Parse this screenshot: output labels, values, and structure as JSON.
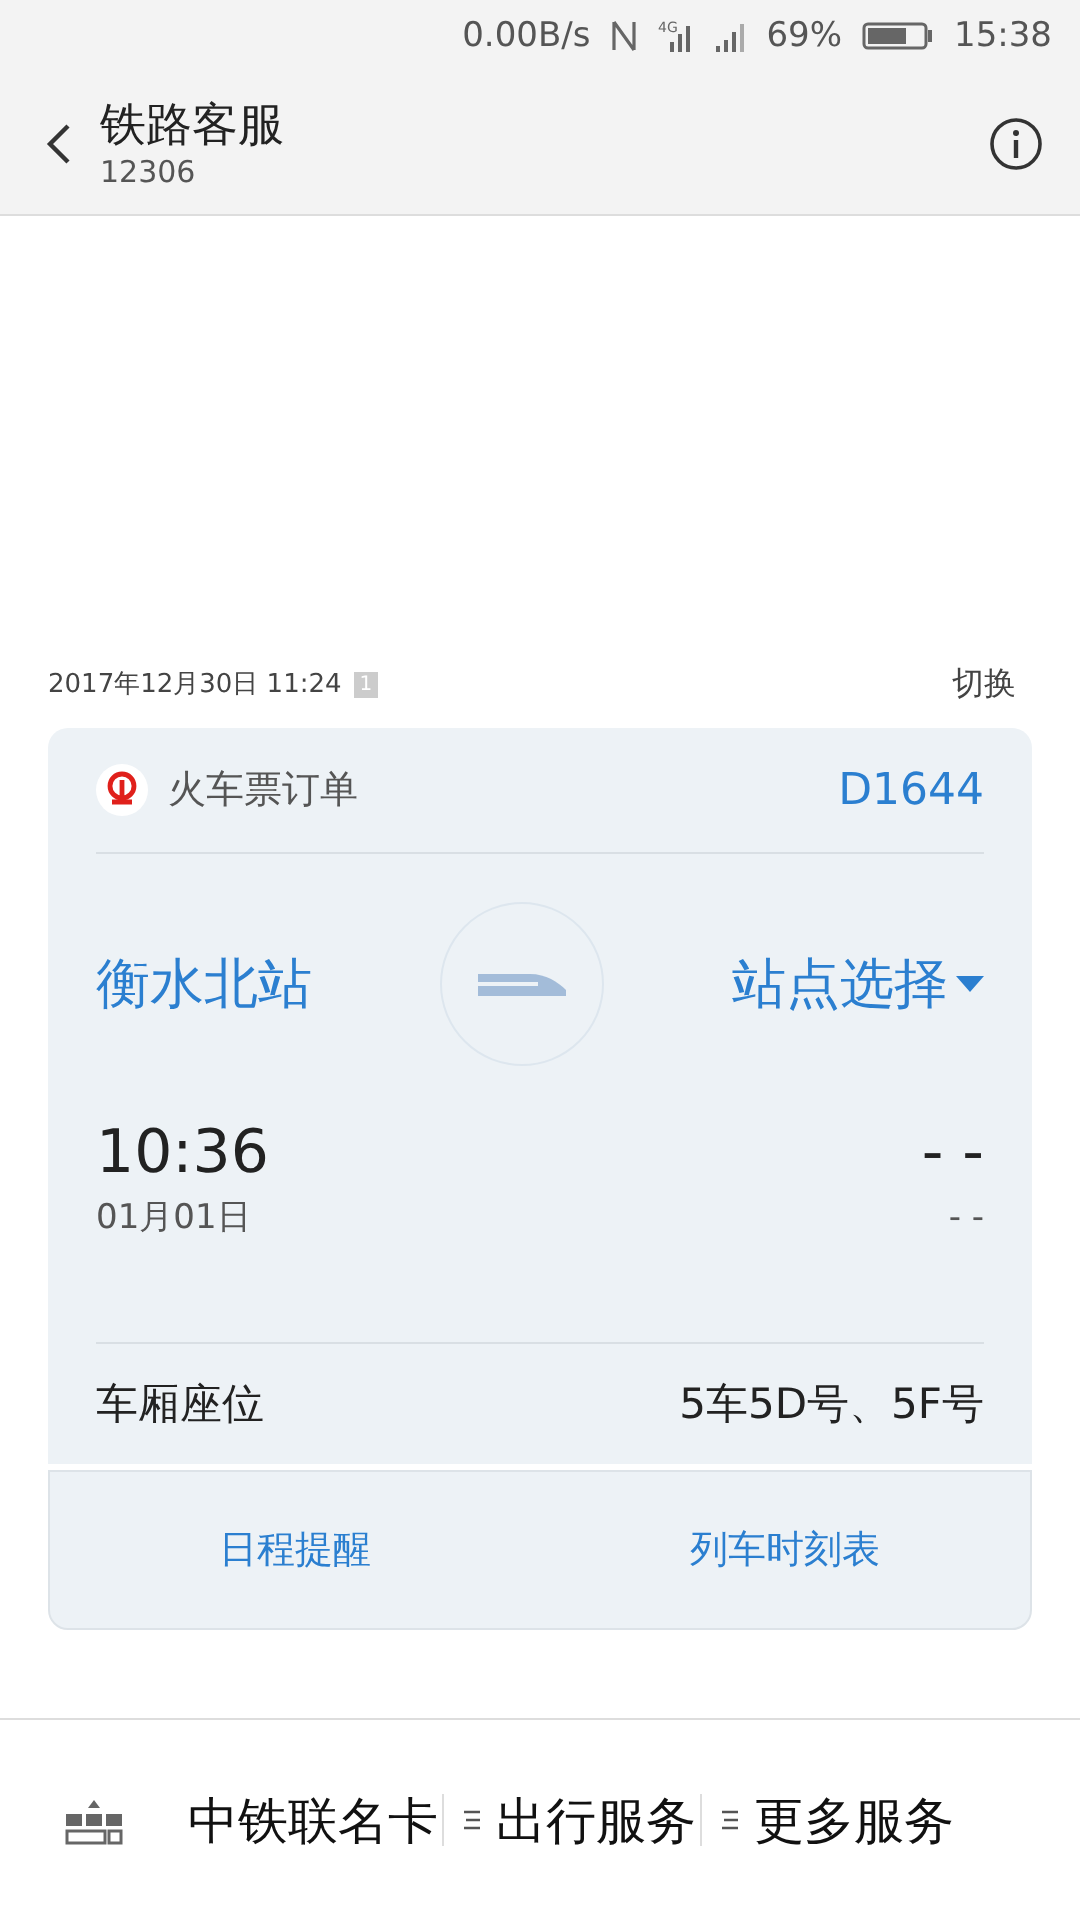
{
  "status_bar": {
    "net_speed": "0.00B/s",
    "network_type": "4G",
    "battery": "69%",
    "time": "15:38"
  },
  "header": {
    "title": "铁路客服",
    "subtitle": "12306"
  },
  "message": {
    "timestamp": "2017年12月30日 11:24",
    "badge": "1",
    "action": "切换"
  },
  "card": {
    "type": "火车票订单",
    "train": "D1644",
    "from_station": "衡水北站",
    "to_station": "站点选择",
    "depart_time": "10:36",
    "depart_date": "01月01日",
    "arrive_time": "- -",
    "arrive_date": "- -",
    "seat_label": "车厢座位",
    "seat_value": "5车5D号、5F号"
  },
  "actions": [
    "日程提醒",
    "列车时刻表"
  ],
  "bottom_menu": [
    {
      "label": "中铁联名卡",
      "has_submenu": false
    },
    {
      "label": "出行服务",
      "has_submenu": true
    },
    {
      "label": "更多服务",
      "has_submenu": true
    }
  ]
}
